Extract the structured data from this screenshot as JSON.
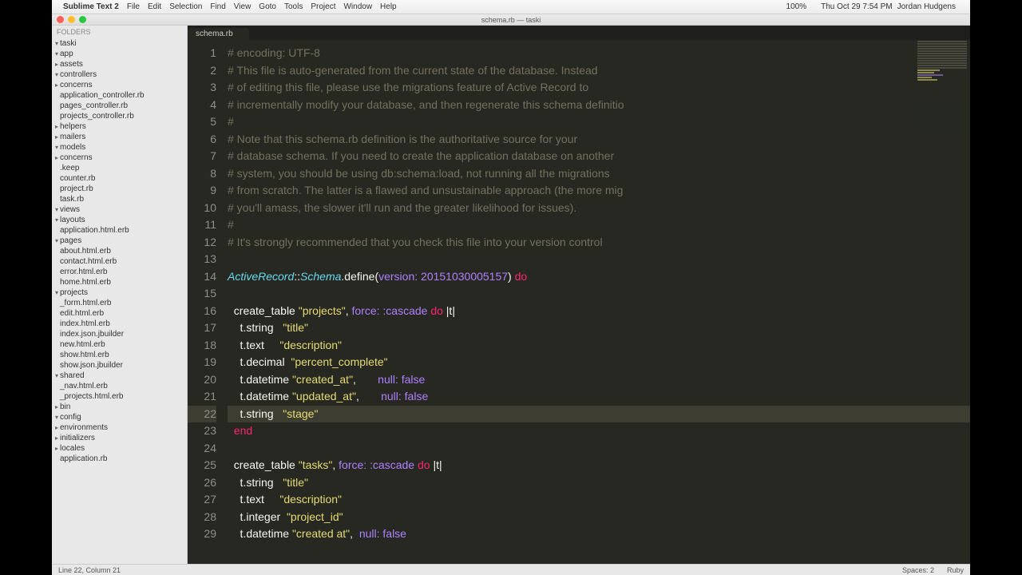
{
  "menubar": {
    "apple": "",
    "appname": "Sublime Text 2",
    "items": [
      "File",
      "Edit",
      "Selection",
      "Find",
      "View",
      "Goto",
      "Tools",
      "Project",
      "Window",
      "Help"
    ],
    "right": [
      "",
      "",
      "",
      "",
      "",
      "",
      "",
      "",
      "",
      "",
      "100%",
      "",
      "",
      "Thu Oct 29  7:54 PM",
      "Jordan Hudgens",
      "",
      ""
    ]
  },
  "window": {
    "title": "schema.rb — taski"
  },
  "sidebar": {
    "header": "FOLDERS",
    "tree": [
      {
        "d": 0,
        "a": "▾",
        "t": "taski"
      },
      {
        "d": 1,
        "a": "▾",
        "t": "app"
      },
      {
        "d": 2,
        "a": "▸",
        "t": "assets"
      },
      {
        "d": 2,
        "a": "▾",
        "t": "controllers"
      },
      {
        "d": 3,
        "a": "▸",
        "t": "concerns"
      },
      {
        "d": 3,
        "a": "",
        "t": "application_controller.rb"
      },
      {
        "d": 3,
        "a": "",
        "t": "pages_controller.rb"
      },
      {
        "d": 3,
        "a": "",
        "t": "projects_controller.rb"
      },
      {
        "d": 2,
        "a": "▸",
        "t": "helpers"
      },
      {
        "d": 2,
        "a": "▸",
        "t": "mailers"
      },
      {
        "d": 2,
        "a": "▾",
        "t": "models"
      },
      {
        "d": 3,
        "a": "▸",
        "t": "concerns"
      },
      {
        "d": 3,
        "a": "",
        "t": ".keep"
      },
      {
        "d": 3,
        "a": "",
        "t": "counter.rb"
      },
      {
        "d": 3,
        "a": "",
        "t": "project.rb"
      },
      {
        "d": 3,
        "a": "",
        "t": "task.rb"
      },
      {
        "d": 2,
        "a": "▾",
        "t": "views"
      },
      {
        "d": 3,
        "a": "▾",
        "t": "layouts"
      },
      {
        "d": 4,
        "a": "",
        "t": "application.html.erb"
      },
      {
        "d": 3,
        "a": "▾",
        "t": "pages"
      },
      {
        "d": 4,
        "a": "",
        "t": "about.html.erb"
      },
      {
        "d": 4,
        "a": "",
        "t": "contact.html.erb"
      },
      {
        "d": 4,
        "a": "",
        "t": "error.html.erb"
      },
      {
        "d": 4,
        "a": "",
        "t": "home.html.erb"
      },
      {
        "d": 3,
        "a": "▾",
        "t": "projects"
      },
      {
        "d": 4,
        "a": "",
        "t": "_form.html.erb"
      },
      {
        "d": 4,
        "a": "",
        "t": "edit.html.erb"
      },
      {
        "d": 4,
        "a": "",
        "t": "index.html.erb"
      },
      {
        "d": 4,
        "a": "",
        "t": "index.json.jbuilder"
      },
      {
        "d": 4,
        "a": "",
        "t": "new.html.erb"
      },
      {
        "d": 4,
        "a": "",
        "t": "show.html.erb"
      },
      {
        "d": 4,
        "a": "",
        "t": "show.json.jbuilder"
      },
      {
        "d": 3,
        "a": "▾",
        "t": "shared"
      },
      {
        "d": 4,
        "a": "",
        "t": "_nav.html.erb"
      },
      {
        "d": 4,
        "a": "",
        "t": "_projects.html.erb"
      },
      {
        "d": 1,
        "a": "▸",
        "t": "bin"
      },
      {
        "d": 1,
        "a": "▾",
        "t": "config"
      },
      {
        "d": 2,
        "a": "▸",
        "t": "environments"
      },
      {
        "d": 2,
        "a": "▸",
        "t": "initializers"
      },
      {
        "d": 2,
        "a": "▸",
        "t": "locales"
      },
      {
        "d": 2,
        "a": "",
        "t": "application.rb"
      }
    ]
  },
  "tab": {
    "label": "schema.rb"
  },
  "code": {
    "cursor_line": 22,
    "lines": [
      {
        "n": 1,
        "seg": [
          [
            "cmnt",
            "# encoding: UTF-8"
          ]
        ]
      },
      {
        "n": 2,
        "seg": [
          [
            "cmnt",
            "# This file is auto-generated from the current state of the database. Instead"
          ]
        ]
      },
      {
        "n": 3,
        "seg": [
          [
            "cmnt",
            "# of editing this file, please use the migrations feature of Active Record to"
          ]
        ]
      },
      {
        "n": 4,
        "seg": [
          [
            "cmnt",
            "# incrementally modify your database, and then regenerate this schema definitio"
          ]
        ]
      },
      {
        "n": 5,
        "seg": [
          [
            "cmnt",
            "#"
          ]
        ]
      },
      {
        "n": 6,
        "seg": [
          [
            "cmnt",
            "# Note that this schema.rb definition is the authoritative source for your"
          ]
        ]
      },
      {
        "n": 7,
        "seg": [
          [
            "cmnt",
            "# database schema. If you need to create the application database on another"
          ]
        ]
      },
      {
        "n": 8,
        "seg": [
          [
            "cmnt",
            "# system, you should be using db:schema:load, not running all the migrations"
          ]
        ]
      },
      {
        "n": 9,
        "seg": [
          [
            "cmnt",
            "# from scratch. The latter is a flawed and unsustainable approach (the more mig"
          ]
        ]
      },
      {
        "n": 10,
        "seg": [
          [
            "cmnt",
            "# you'll amass, the slower it'll run and the greater likelihood for issues)."
          ]
        ]
      },
      {
        "n": 11,
        "seg": [
          [
            "cmnt",
            "#"
          ]
        ]
      },
      {
        "n": 12,
        "seg": [
          [
            "cmnt",
            "# It's strongly recommended that you check this file into your version control "
          ]
        ]
      },
      {
        "n": 13,
        "seg": [
          [
            "",
            ""
          ]
        ]
      },
      {
        "n": 14,
        "seg": [
          [
            "cls",
            "ActiveRecord"
          ],
          [
            "",
            "::"
          ],
          [
            "cls",
            "Schema"
          ],
          [
            "",
            ".define("
          ],
          [
            "sym",
            "version:"
          ],
          [
            "",
            " "
          ],
          [
            "num",
            "20151030005157"
          ],
          [
            "",
            ") "
          ],
          [
            "kw",
            "do"
          ]
        ]
      },
      {
        "n": 15,
        "seg": [
          [
            "",
            ""
          ]
        ]
      },
      {
        "n": 16,
        "seg": [
          [
            "",
            "  create_table "
          ],
          [
            "str",
            "\"projects\""
          ],
          [
            "",
            ", "
          ],
          [
            "sym",
            "force:"
          ],
          [
            "",
            " "
          ],
          [
            "sym",
            ":cascade"
          ],
          [
            "",
            " "
          ],
          [
            "kw",
            "do"
          ],
          [
            "",
            " |t|"
          ]
        ]
      },
      {
        "n": 17,
        "seg": [
          [
            "",
            "    t.string   "
          ],
          [
            "str",
            "\"title\""
          ]
        ]
      },
      {
        "n": 18,
        "seg": [
          [
            "",
            "    t.text     "
          ],
          [
            "str",
            "\"description\""
          ]
        ]
      },
      {
        "n": 19,
        "seg": [
          [
            "",
            "    t.decimal  "
          ],
          [
            "str",
            "\"percent_complete\""
          ]
        ]
      },
      {
        "n": 20,
        "seg": [
          [
            "",
            "    t.datetime "
          ],
          [
            "str",
            "\"created_at\""
          ],
          [
            "",
            ",       "
          ],
          [
            "sym",
            "null:"
          ],
          [
            "",
            " "
          ],
          [
            "const",
            "false"
          ]
        ]
      },
      {
        "n": 21,
        "seg": [
          [
            "",
            "    t.datetime "
          ],
          [
            "str",
            "\"updated_at\""
          ],
          [
            "",
            ",       "
          ],
          [
            "sym",
            "null:"
          ],
          [
            "",
            " "
          ],
          [
            "const",
            "false"
          ]
        ]
      },
      {
        "n": 22,
        "seg": [
          [
            "",
            "    t.string   "
          ],
          [
            "str",
            "\"stage\""
          ]
        ]
      },
      {
        "n": 23,
        "seg": [
          [
            "",
            "  "
          ],
          [
            "kw",
            "end"
          ]
        ]
      },
      {
        "n": 24,
        "seg": [
          [
            "",
            ""
          ]
        ]
      },
      {
        "n": 25,
        "seg": [
          [
            "",
            "  create_table "
          ],
          [
            "str",
            "\"tasks\""
          ],
          [
            "",
            ", "
          ],
          [
            "sym",
            "force:"
          ],
          [
            "",
            " "
          ],
          [
            "sym",
            ":cascade"
          ],
          [
            "",
            " "
          ],
          [
            "kw",
            "do"
          ],
          [
            "",
            " |t|"
          ]
        ]
      },
      {
        "n": 26,
        "seg": [
          [
            "",
            "    t.string   "
          ],
          [
            "str",
            "\"title\""
          ]
        ]
      },
      {
        "n": 27,
        "seg": [
          [
            "",
            "    t.text     "
          ],
          [
            "str",
            "\"description\""
          ]
        ]
      },
      {
        "n": 28,
        "seg": [
          [
            "",
            "    t.integer  "
          ],
          [
            "str",
            "\"project_id\""
          ]
        ]
      },
      {
        "n": 29,
        "seg": [
          [
            "",
            "    t.datetime "
          ],
          [
            "str",
            "\"created at\""
          ],
          [
            "",
            ",  "
          ],
          [
            "sym",
            "null:"
          ],
          [
            "",
            " "
          ],
          [
            "const",
            "false"
          ]
        ]
      }
    ]
  },
  "status": {
    "left": "Line 22, Column 21",
    "spaces": "Spaces: 2",
    "lang": "Ruby"
  }
}
